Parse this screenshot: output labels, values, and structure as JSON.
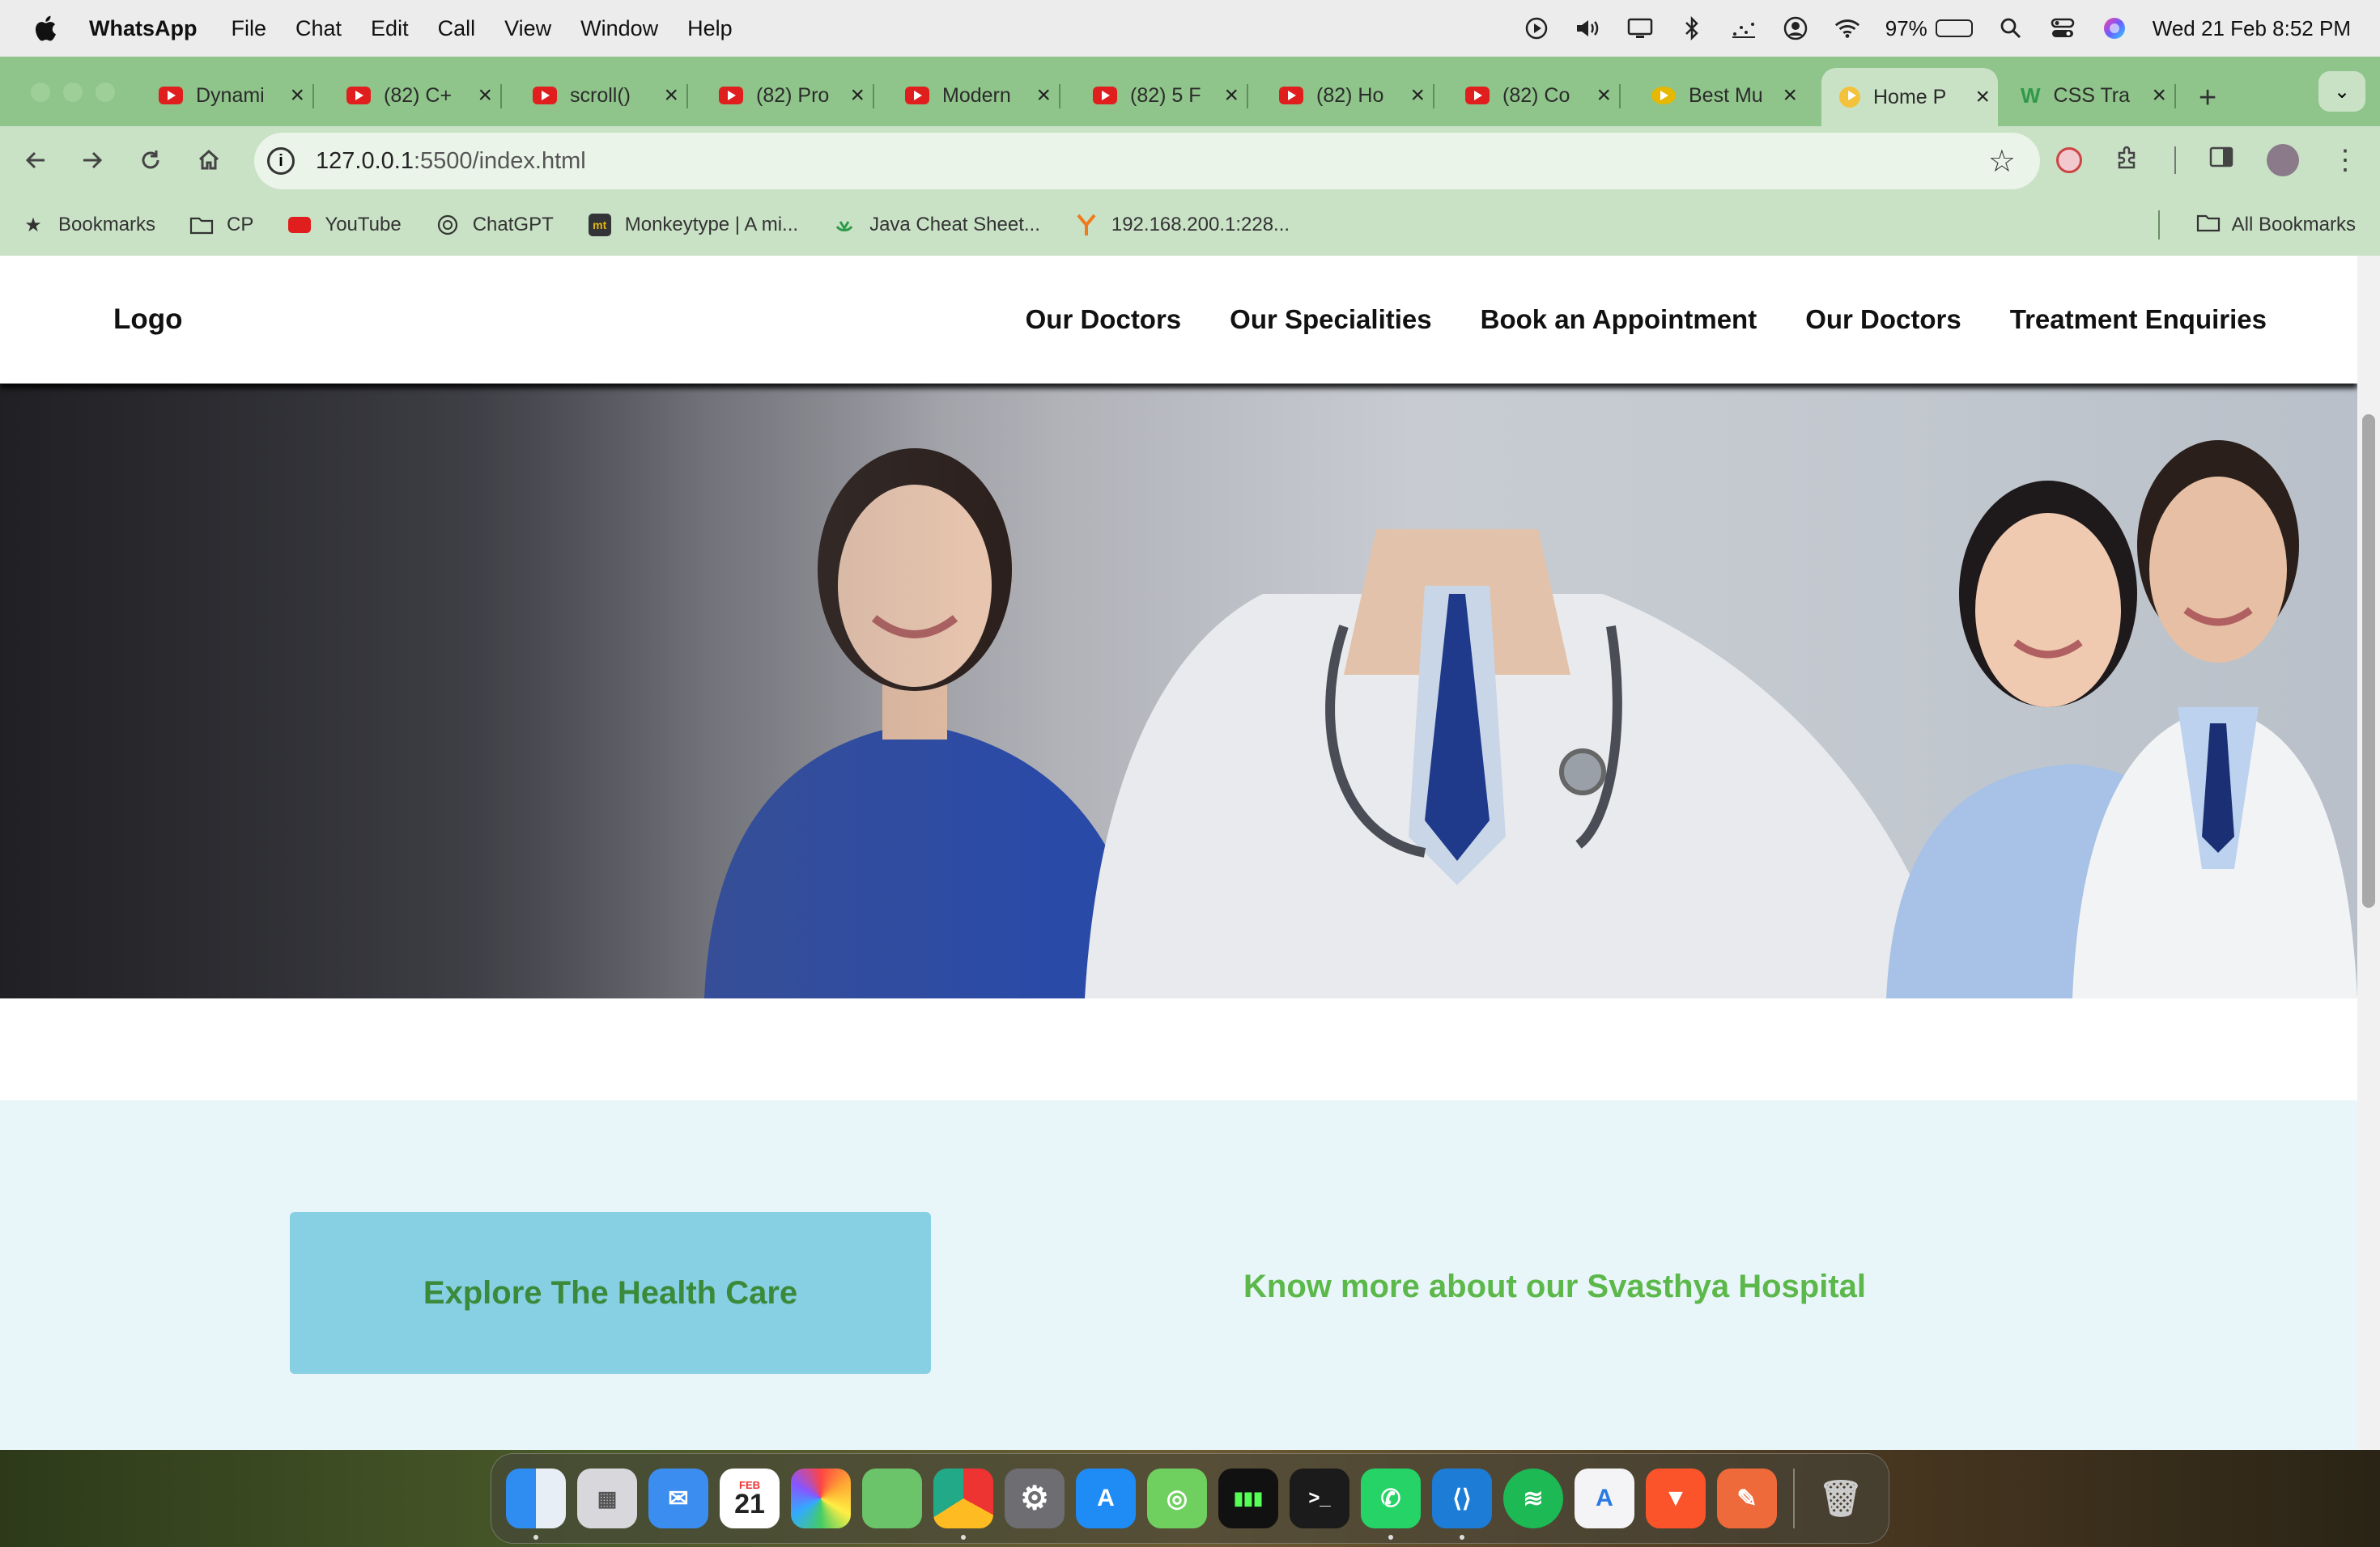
{
  "menubar": {
    "app_name": "WhatsApp",
    "menus": [
      "File",
      "Chat",
      "Edit",
      "Call",
      "View",
      "Window",
      "Help"
    ],
    "battery_percent": "97%",
    "battery_level": 0.97,
    "datetime": "Wed 21 Feb  8:52 PM"
  },
  "browser": {
    "tabs": [
      {
        "title": "Dynami",
        "icon": "youtube-icon"
      },
      {
        "title": "(82) C+",
        "icon": "youtube-icon"
      },
      {
        "title": "scroll()",
        "icon": "youtube-icon"
      },
      {
        "title": "(82) Pro",
        "icon": "youtube-icon"
      },
      {
        "title": "Modern",
        "icon": "youtube-icon"
      },
      {
        "title": "(82) 5 F",
        "icon": "youtube-icon"
      },
      {
        "title": "(82) Ho",
        "icon": "youtube-icon"
      },
      {
        "title": "(82) Co",
        "icon": "youtube-icon"
      },
      {
        "title": "Best Mu",
        "icon": "mum-icon"
      },
      {
        "title": "Home P",
        "icon": "sun-icon",
        "active": true
      },
      {
        "title": "CSS Tra",
        "icon": "w-icon"
      }
    ],
    "url_host": "127.0.0.1",
    "url_rest": ":5500/index.html",
    "bookmarks": [
      {
        "label": "Bookmarks",
        "icon": "star-icon"
      },
      {
        "label": "CP",
        "icon": "folder-icon"
      },
      {
        "label": "YouTube",
        "icon": "youtube-icon"
      },
      {
        "label": "ChatGPT",
        "icon": "chatgpt-icon"
      },
      {
        "label": "Monkeytype | A mi...",
        "icon": "monkeytype-icon"
      },
      {
        "label": "Java Cheat Sheet...",
        "icon": "java-icon"
      },
      {
        "label": "192.168.200.1:228...",
        "icon": "router-icon"
      }
    ],
    "all_bookmarks": "All Bookmarks"
  },
  "site": {
    "logo": "Logo",
    "nav": [
      "Our Doctors",
      "Our Specialities",
      "Book an Appointment",
      "Our Doctors",
      "Treatment Enquiries"
    ],
    "explore_button": "Explore The Health Care",
    "about_text": "Know more about our Svasthya Hospital"
  },
  "calendar": {
    "month": "FEB",
    "day": "21"
  },
  "colors": {
    "tab_strip": "#8fc48a",
    "toolbar": "#c9e2c6",
    "about_bg": "#e8f5f9",
    "button_bg": "#87cfe3",
    "button_text": "#3a8a3a",
    "about_text": "#5cb84a"
  }
}
